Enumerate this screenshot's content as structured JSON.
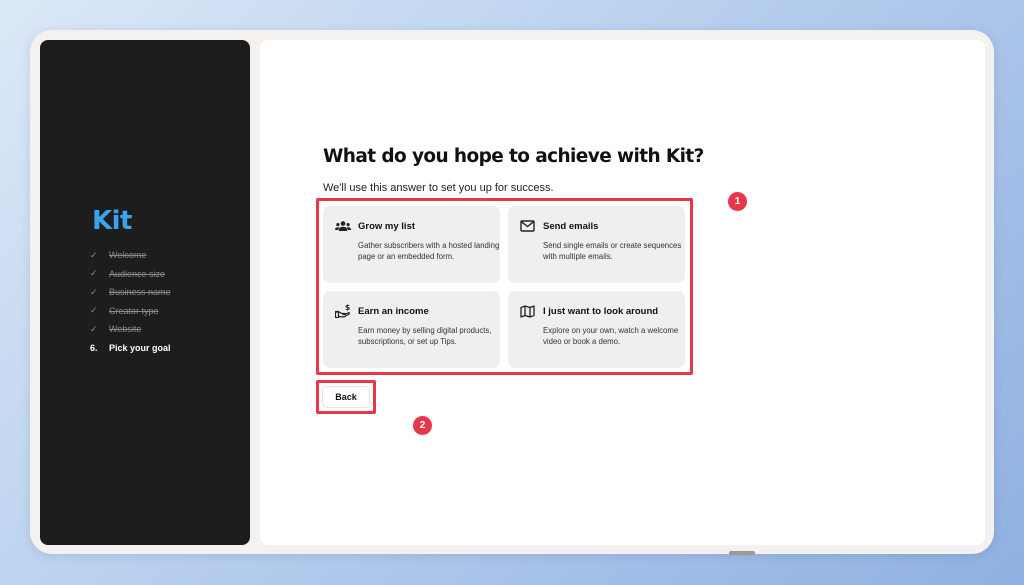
{
  "sidebar": {
    "logo": "Kit",
    "steps": [
      {
        "mark": "✓",
        "label": "Welcome",
        "state": "done"
      },
      {
        "mark": "✓",
        "label": "Audience size",
        "state": "done"
      },
      {
        "mark": "✓",
        "label": "Business name",
        "state": "done"
      },
      {
        "mark": "✓",
        "label": "Creator type",
        "state": "done"
      },
      {
        "mark": "✓",
        "label": "Website",
        "state": "done"
      },
      {
        "mark": "6.",
        "label": "Pick your goal",
        "state": "current"
      }
    ]
  },
  "main": {
    "title": "What do you hope to achieve with Kit?",
    "subtitle": "We'll use this answer to set you up for success.",
    "options": [
      {
        "icon": "users-icon",
        "title": "Grow my list",
        "description": "Gather subscribers with a hosted landing page or an embedded form."
      },
      {
        "icon": "envelope-icon",
        "title": "Send emails",
        "description": "Send single emails or create sequences with multiple emails."
      },
      {
        "icon": "hand-money-icon",
        "title": "Earn an income",
        "description": "Earn money by selling digital products, subscriptions, or set up Tips."
      },
      {
        "icon": "map-icon",
        "title": "I just want to look around",
        "description": "Explore on your own, watch a welcome video or book a demo."
      }
    ],
    "back_label": "Back"
  },
  "annotations": {
    "badge_1": "1",
    "badge_2": "2",
    "color": "#e8364a"
  },
  "colors": {
    "brand": "#3aa3f0",
    "sidebar_bg": "#1d1d1d",
    "card_bg": "#efefef"
  }
}
